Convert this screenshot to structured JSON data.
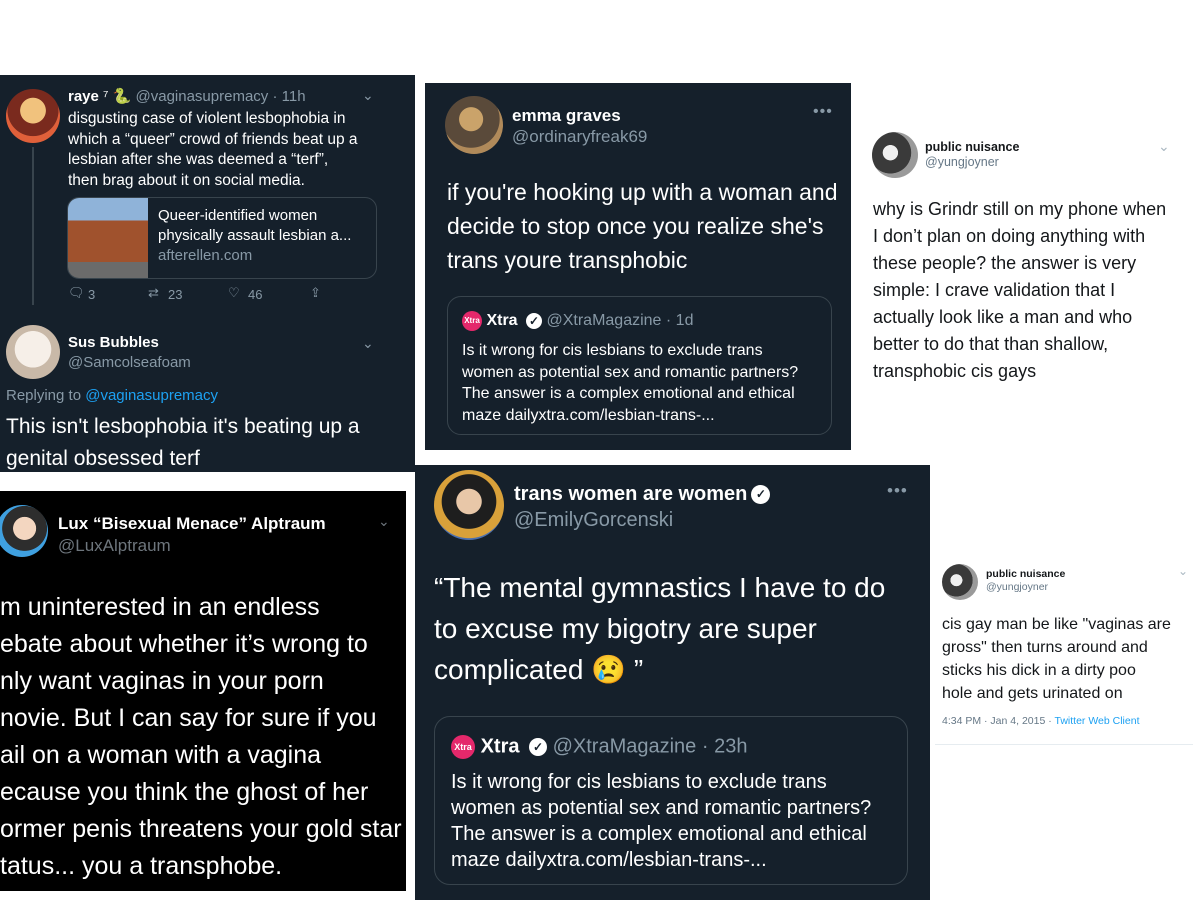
{
  "tweet_raye": {
    "display_name": "raye",
    "name_extra": "⁷ 🐍",
    "handle": "@vaginasupremacy · 11h",
    "text_lines": [
      "disgusting case of violent lesbophobia in",
      "which a “queer” crowd of friends beat up a",
      "lesbian after she was deemed a “terf”,",
      "then brag about it on social media."
    ],
    "card_title_lines": [
      "Queer-identified women",
      "physically assault lesbian a..."
    ],
    "card_domain": "afterellen.com",
    "reply_count": "3",
    "retweet_count": "23",
    "like_count": "46"
  },
  "tweet_sus": {
    "display_name": "Sus Bubbles",
    "handle": "@Samcolseafoam",
    "replying_to_prefix": "Replying to",
    "replying_to_handle": "@vaginasupremacy",
    "text_lines": [
      "This isn't lesbophobia it's beating up a",
      "genital obsessed terf"
    ]
  },
  "tweet_emma": {
    "display_name": "emma graves",
    "handle": "@ordinaryfreak69",
    "text_lines": [
      "if you're hooking up with a woman and",
      "decide to stop once you realize she's",
      "trans youre transphobic"
    ],
    "quote": {
      "logo_text": "Xtra",
      "display_name": "Xtra",
      "handle": "@XtraMagazine · 1d",
      "text_lines": [
        "Is it wrong for cis lesbians to exclude trans",
        "women as potential sex and romantic partners?",
        "The answer is a complex emotional and ethical",
        "maze dailyxtra.com/lesbian-trans-..."
      ]
    }
  },
  "tweet_public1": {
    "display_name": "public nuisance",
    "handle": "@yungjoyner",
    "text_lines": [
      "why is Grindr still on my phone when",
      "I don’t plan on doing anything with",
      "these people? the answer is very",
      "simple: I crave validation that I",
      "actually look like a man and who",
      "better to do that than shallow,",
      "transphobic cis gays"
    ]
  },
  "tweet_lux": {
    "display_name": "Lux “Bisexual Menace” Alptraum",
    "handle": "@LuxAlptraum",
    "text_lines": [
      "m uninterested in an endless",
      "ebate about whether it’s wrong to",
      "nly want vaginas in your porn",
      "novie. But I can say for sure if you",
      "ail on a woman with a vagina",
      "ecause you think the ghost of her",
      "ormer penis threatens your gold star",
      "tatus... you a transphobe."
    ]
  },
  "tweet_twaw": {
    "display_name": "trans women are women",
    "handle": "@EmilyGorcenski",
    "text_lines": [
      "“The mental gymnastics I have to do",
      "to excuse my bigotry are super",
      "complicated 😢 ”"
    ],
    "quote": {
      "logo_text": "Xtra",
      "display_name": "Xtra",
      "handle": "@XtraMagazine · 23h",
      "text_lines": [
        "Is it wrong for cis lesbians to exclude trans",
        "women as potential sex and romantic partners?",
        "The answer is a complex emotional and ethical",
        "maze dailyxtra.com/lesbian-trans-..."
      ]
    }
  },
  "tweet_public2": {
    "display_name": "public nuisance",
    "handle": "@yungjoyner",
    "text_lines": [
      "cis gay man be like \"vaginas are",
      "gross\" then turns around and",
      "sticks his dick in a dirty poo",
      "hole and gets urinated on"
    ],
    "timestamp": "4:34 PM · Jan 4, 2015",
    "separator": "·",
    "client": "Twitter Web Client"
  }
}
